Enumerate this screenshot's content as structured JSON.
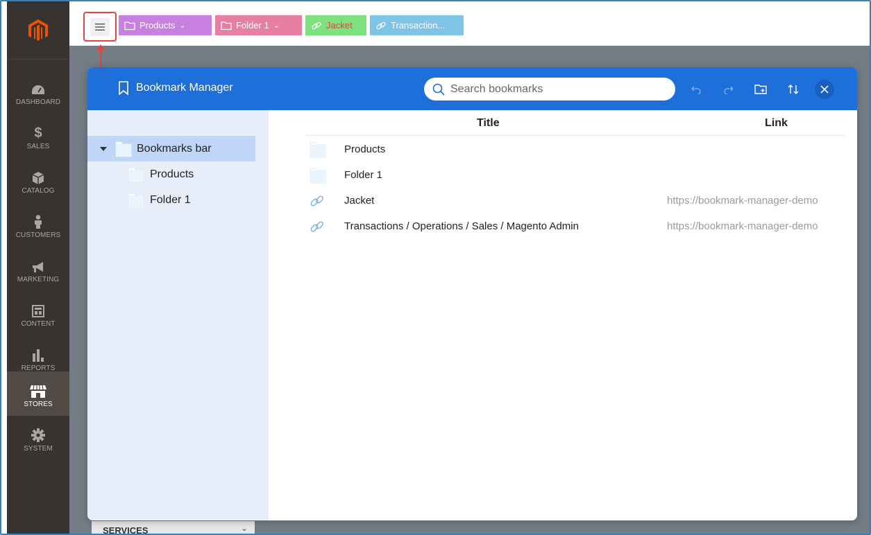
{
  "sidebar": {
    "items": [
      {
        "label": "DASHBOARD",
        "icon": "dashboard-icon"
      },
      {
        "label": "SALES",
        "icon": "dollar-icon"
      },
      {
        "label": "CATALOG",
        "icon": "catalog-box-icon"
      },
      {
        "label": "CUSTOMERS",
        "icon": "customer-icon"
      },
      {
        "label": "MARKETING",
        "icon": "megaphone-icon"
      },
      {
        "label": "CONTENT",
        "icon": "content-layout-icon"
      },
      {
        "label": "REPORTS",
        "icon": "bar-chart-icon"
      },
      {
        "label": "STORES",
        "icon": "storefront-icon"
      },
      {
        "label": "SYSTEM",
        "icon": "gear-icon"
      }
    ],
    "active": "STORES",
    "services_label": "SERVICES"
  },
  "bookmark_bar": {
    "chips": [
      {
        "label": "Products",
        "icon": "folder-icon",
        "color": "#c77fe0"
      },
      {
        "label": "Folder 1",
        "icon": "folder-icon",
        "color": "#e67fa3"
      },
      {
        "label": "Jacket",
        "icon": "link-icon",
        "color": "#7fe07f"
      },
      {
        "label": "Transaction...",
        "icon": "link-icon",
        "color": "#7fc3e6"
      }
    ]
  },
  "dialog": {
    "title": "Bookmark Manager",
    "search_placeholder": "Search bookmarks",
    "header_color": "#1e6fd9",
    "tree": {
      "root": "Bookmarks bar",
      "children": [
        "Products",
        "Folder 1"
      ]
    },
    "columns": {
      "title": "Title",
      "link": "Link"
    },
    "rows": [
      {
        "type": "folder",
        "title": "Products",
        "link": ""
      },
      {
        "type": "folder",
        "title": "Folder 1",
        "link": ""
      },
      {
        "type": "link",
        "title": "Jacket",
        "link": "https://bookmark-manager-demo"
      },
      {
        "type": "link",
        "title": "Transactions / Operations / Sales / Magento Admin",
        "link": "https://bookmark-manager-demo"
      }
    ]
  },
  "colors": {
    "magento_sidebar": "#373330",
    "magento_logo": "#eb5202",
    "annotation_red": "#e3443f"
  }
}
